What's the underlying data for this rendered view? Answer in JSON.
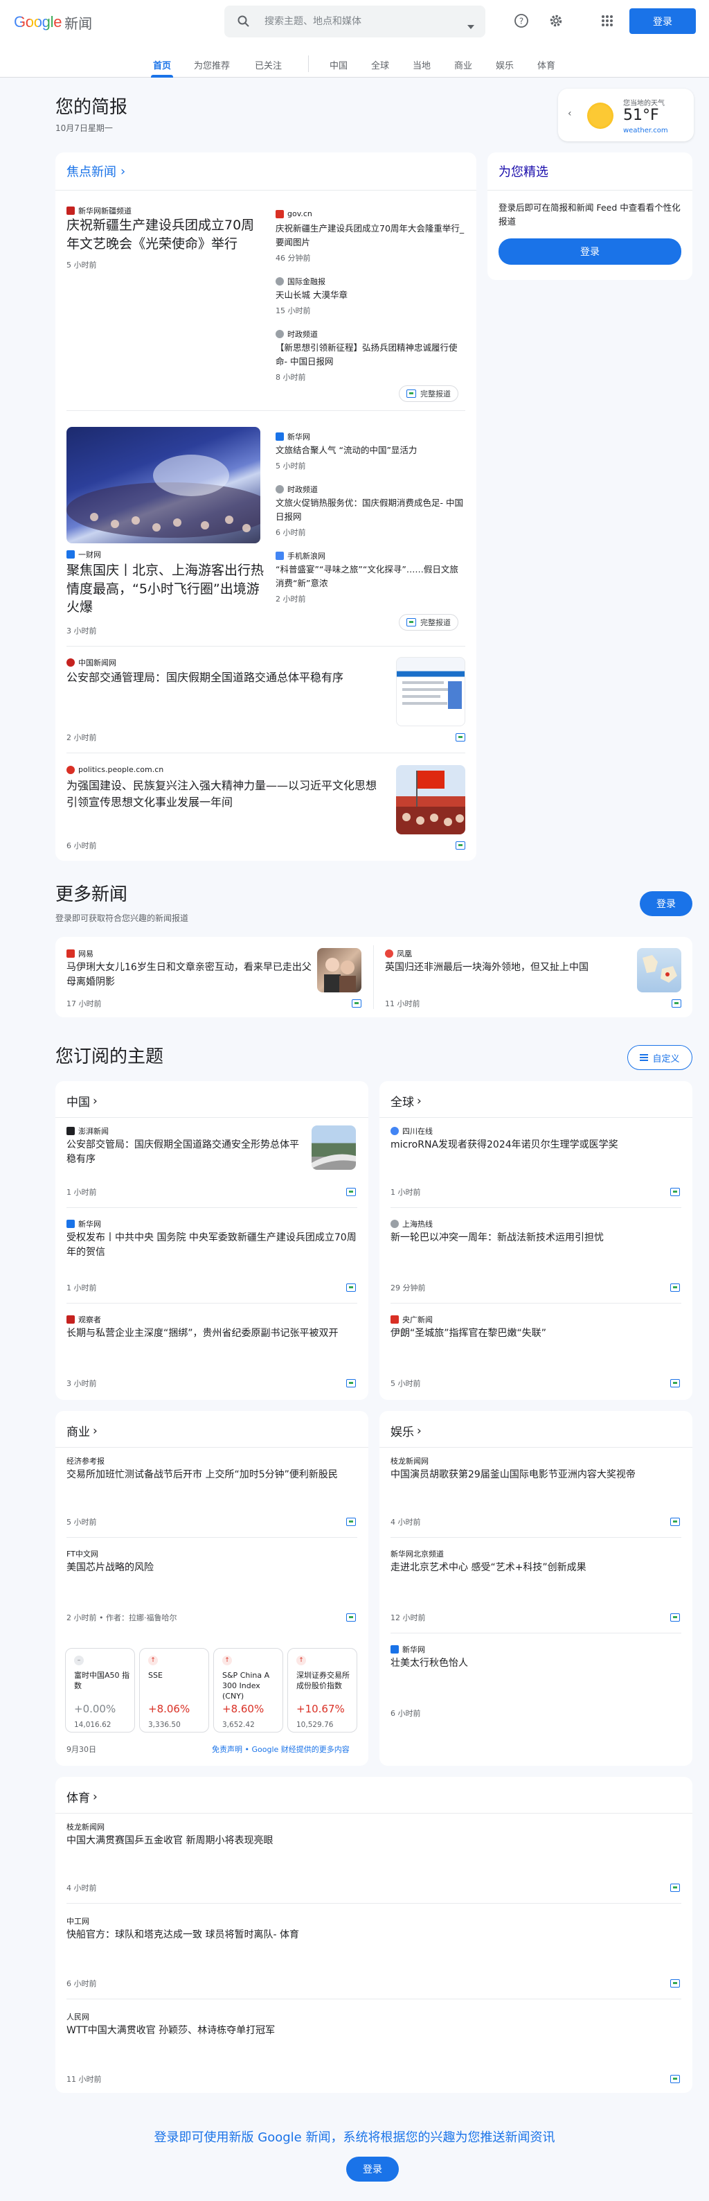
{
  "header": {
    "logo_google": "Google",
    "logo_news": "新闻",
    "search_placeholder": "搜索主题、地点和媒体",
    "signin": "登录"
  },
  "tabs": [
    "首页",
    "为您推荐",
    "已关注",
    "中国",
    "全球",
    "当地",
    "商业",
    "娱乐",
    "体育"
  ],
  "briefing": {
    "title": "您的简报",
    "date": "10月7日星期一"
  },
  "weather": {
    "label": "您当地的天气",
    "temp": "51°F",
    "source": "weather.com"
  },
  "top_stories": {
    "title": "焦点新闻",
    "full_coverage": "完整报道",
    "clusters": [
      {
        "main": {
          "source": "新华网新疆频道",
          "title": "庆祝新疆生产建设兵团成立70周年文艺晚会《光荣使命》举行",
          "time": "5 小时前"
        },
        "related": [
          {
            "source": "gov.cn",
            "title": "庆祝新疆生产建设兵团成立70周年大会隆重举行_要闻图片",
            "time": "46 分钟前"
          },
          {
            "source": "国际金融报",
            "title": "天山长城 大漠华章",
            "time": "15 小时前"
          },
          {
            "source": "时政频道",
            "title": "【新思想引领新征程】弘扬兵团精神忠诚履行使命- 中国日报网",
            "time": "8 小时前"
          }
        ]
      },
      {
        "main": {
          "source": "一财网",
          "title": "聚焦国庆丨北京、上海游客出行热情度最高，“5小时飞行圈”出境游火爆",
          "time": "3 小时前"
        },
        "related": [
          {
            "source": "新华网",
            "title": "文旅结合聚人气 “流动的中国”显活力",
            "time": "5 小时前"
          },
          {
            "source": "时政频道",
            "title": "文旅火促销热服务优：国庆假期消费成色足- 中国日报网",
            "time": "6 小时前"
          },
          {
            "source": "手机新浪网",
            "title": "“科普盛宴”“寻味之旅”“文化探寻”……假日文旅消费“新”意浓",
            "time": "2 小时前"
          }
        ]
      }
    ],
    "singles": [
      {
        "source": "中国新闻网",
        "title": "公安部交通管理局：国庆假期全国道路交通总体平稳有序",
        "time": "2 小时前"
      },
      {
        "source": "politics.people.com.cn",
        "title": "为强国建设、民族复兴注入强大精神力量——以习近平文化思想引领宣传思想文化事业发展一年间",
        "time": "6 小时前"
      }
    ]
  },
  "for_you": {
    "title": "为您精选",
    "desc": "登录后即可在简报和新闻 Feed 中查看看个性化报道",
    "button": "登录"
  },
  "more_news": {
    "title": "更多新闻",
    "desc": "登录即可获取符合您兴趣的新闻报道",
    "button": "登录",
    "items": [
      {
        "source": "网易",
        "title": "马伊琍大女儿16岁生日和文章亲密互动，看来早已走出父母离婚阴影",
        "time": "17 小时前"
      },
      {
        "source": "凤凰",
        "title": "英国归还非洲最后一块海外领地，但又扯上中国",
        "time": "11 小时前"
      }
    ]
  },
  "topics": {
    "title": "您订阅的主题",
    "customize": "自定义",
    "china": {
      "title": "中国",
      "items": [
        {
          "source": "澎湃新闻",
          "title": "公安部交管局：国庆假期全国道路交通安全形势总体平稳有序",
          "time": "1 小时前"
        },
        {
          "source": "新华网",
          "title": "受权发布丨中共中央 国务院 中央军委致新疆生产建设兵团成立70周年的贺信",
          "time": "1 小时前"
        },
        {
          "source": "观察者",
          "title": "长期与私营企业主深度“捆绑”，贵州省纪委原副书记张平被双开",
          "time": "3 小时前"
        }
      ]
    },
    "world": {
      "title": "全球",
      "items": [
        {
          "source": "四川在线",
          "title": "microRNA发现者获得2024年诺贝尔生理学或医学奖",
          "time": "1 小时前"
        },
        {
          "source": "上海热线",
          "title": "新一轮巴以冲突一周年：新战法新技术运用引担忧",
          "time": "29 分钟前"
        },
        {
          "source": "央广新闻",
          "title": "伊朗“圣城旅”指挥官在黎巴嫩“失联”",
          "time": "5 小时前"
        }
      ]
    },
    "business": {
      "title": "商业",
      "items": [
        {
          "source": "经济参考报",
          "title": "交易所加班忙测试备战节后开市 上交所“加时5分钟”便利新股民",
          "time": "5 小时前"
        },
        {
          "source": "FT中文网",
          "title": "美国芯片战略的风险",
          "time": "2 小时前 • 作者：拉娜·福鲁哈尔"
        }
      ],
      "stocks": [
        {
          "name": "富时中国A50 指数",
          "change": "+0.00%",
          "value": "14,016.62",
          "dir": "flat"
        },
        {
          "name": "SSE",
          "change": "+8.06%",
          "value": "3,336.50",
          "dir": "up"
        },
        {
          "name": "S&P China A 300 Index (CNY)",
          "change": "+8.60%",
          "value": "3,652.42",
          "dir": "up"
        },
        {
          "name": "深圳证券交易所成份股价指数",
          "change": "+10.67%",
          "value": "10,529.76",
          "dir": "up"
        }
      ],
      "stock_date": "9月30日",
      "disclaimer": "免责声明 • Google 财经提供的更多内容"
    },
    "entertainment": {
      "title": "娱乐",
      "items": [
        {
          "source": "枝龙新闻网",
          "title": "中国演员胡歌获第29届釜山国际电影节亚洲内容大奖视帝",
          "time": "4 小时前"
        },
        {
          "source": "新华网北京频道",
          "title": "走进北京艺术中心 感受“艺术+科技”创新成果",
          "time": "12 小时前"
        },
        {
          "source": "新华网",
          "title": "壮美太行秋色怡人",
          "time": "6 小时前"
        }
      ]
    },
    "sports": {
      "title": "体育",
      "items": [
        {
          "source": "枝龙新闻网",
          "title": "中国大满贯赛国乒五金收官 新周期小将表现亮眼",
          "time": "4 小时前"
        },
        {
          "source": "中工网",
          "title": "快船官方：球队和塔克达成一致 球员将暂时离队- 体育",
          "time": "6 小时前"
        },
        {
          "source": "人民网",
          "title": "WTT中国大满贯收官 孙颖莎、林诗栋夺单打冠军",
          "time": "11 小时前"
        }
      ]
    }
  },
  "footer": {
    "prompt": "登录即可使用新版 Google 新闻，系统将根据您的兴趣为您推送新闻资讯",
    "button": "登录"
  }
}
